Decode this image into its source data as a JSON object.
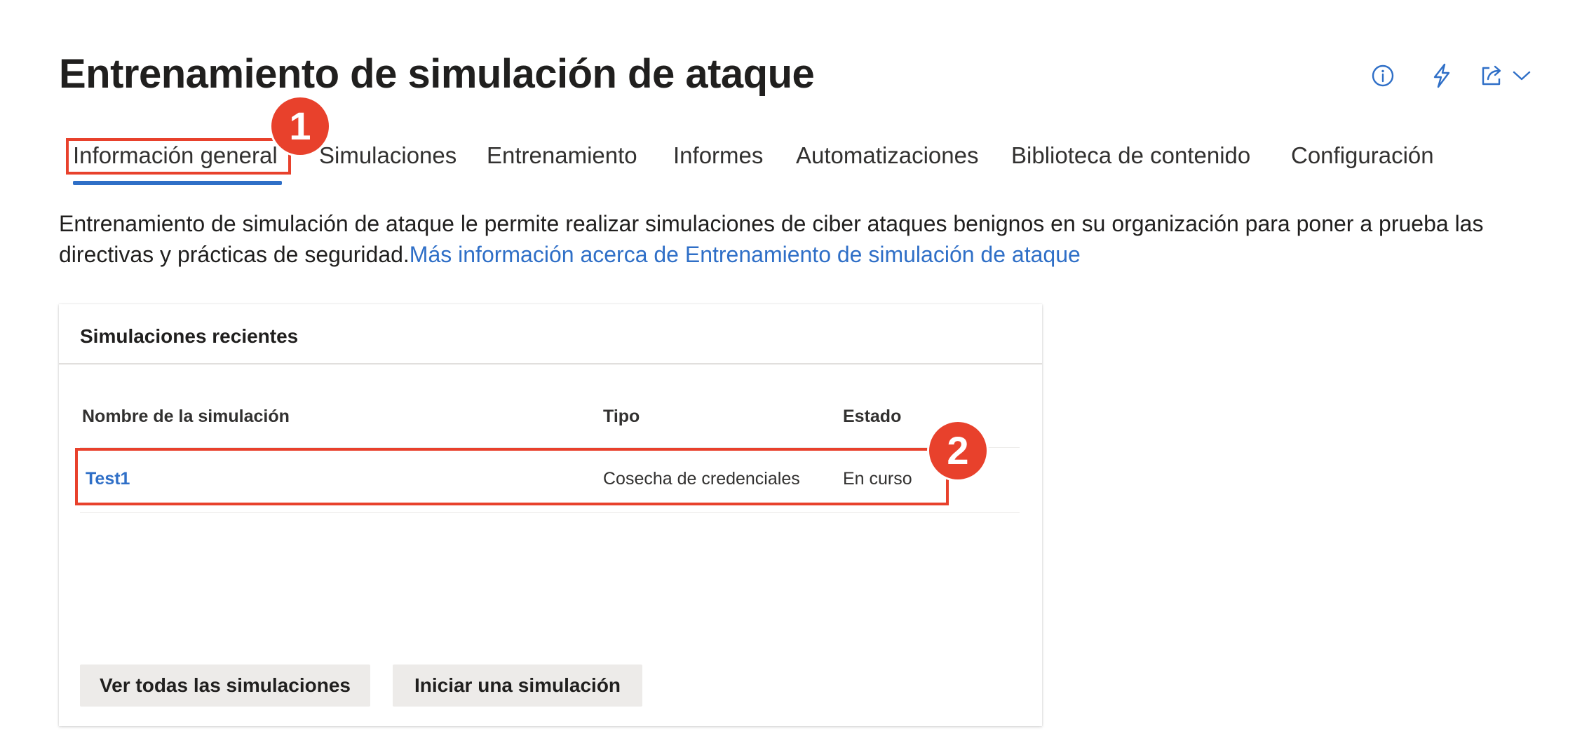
{
  "page": {
    "title": "Entrenamiento de simulación de ataque"
  },
  "top_actions": {
    "info_icon": "info-icon",
    "lightning_icon": "lightning-icon",
    "share_icon": "share-icon",
    "chevron_icon": "chevron-down-icon"
  },
  "tabs": [
    {
      "label": "Información general",
      "selected": true
    },
    {
      "label": "Simulaciones",
      "selected": false
    },
    {
      "label": "Entrenamiento",
      "selected": false
    },
    {
      "label": "Informes",
      "selected": false
    },
    {
      "label": "Automatizaciones",
      "selected": false
    },
    {
      "label": "Biblioteca de contenido",
      "selected": false
    },
    {
      "label": "Configuración",
      "selected": false
    }
  ],
  "intro": {
    "text": "Entrenamiento de simulación de ataque le permite realizar simulaciones de ciber ataques benignos en su organización para poner a prueba las directivas y prácticas de seguridad.",
    "link": "Más información acerca de Entrenamiento de simulación de ataque"
  },
  "recent_simulations": {
    "title": "Simulaciones recientes",
    "columns": [
      "Nombre de la simulación",
      "Tipo",
      "Estado"
    ],
    "rows": [
      {
        "name": "Test1",
        "type": "Cosecha de credenciales",
        "status": "En curso"
      }
    ],
    "view_all_label": "Ver todas las simulaciones",
    "launch_label": "Iniciar una simulación"
  },
  "annotations": {
    "badge1": "1",
    "badge2": "2"
  },
  "colors": {
    "accent": "#2f6fc7",
    "annotation": "#e8412c",
    "button_bg": "#edebe9"
  }
}
